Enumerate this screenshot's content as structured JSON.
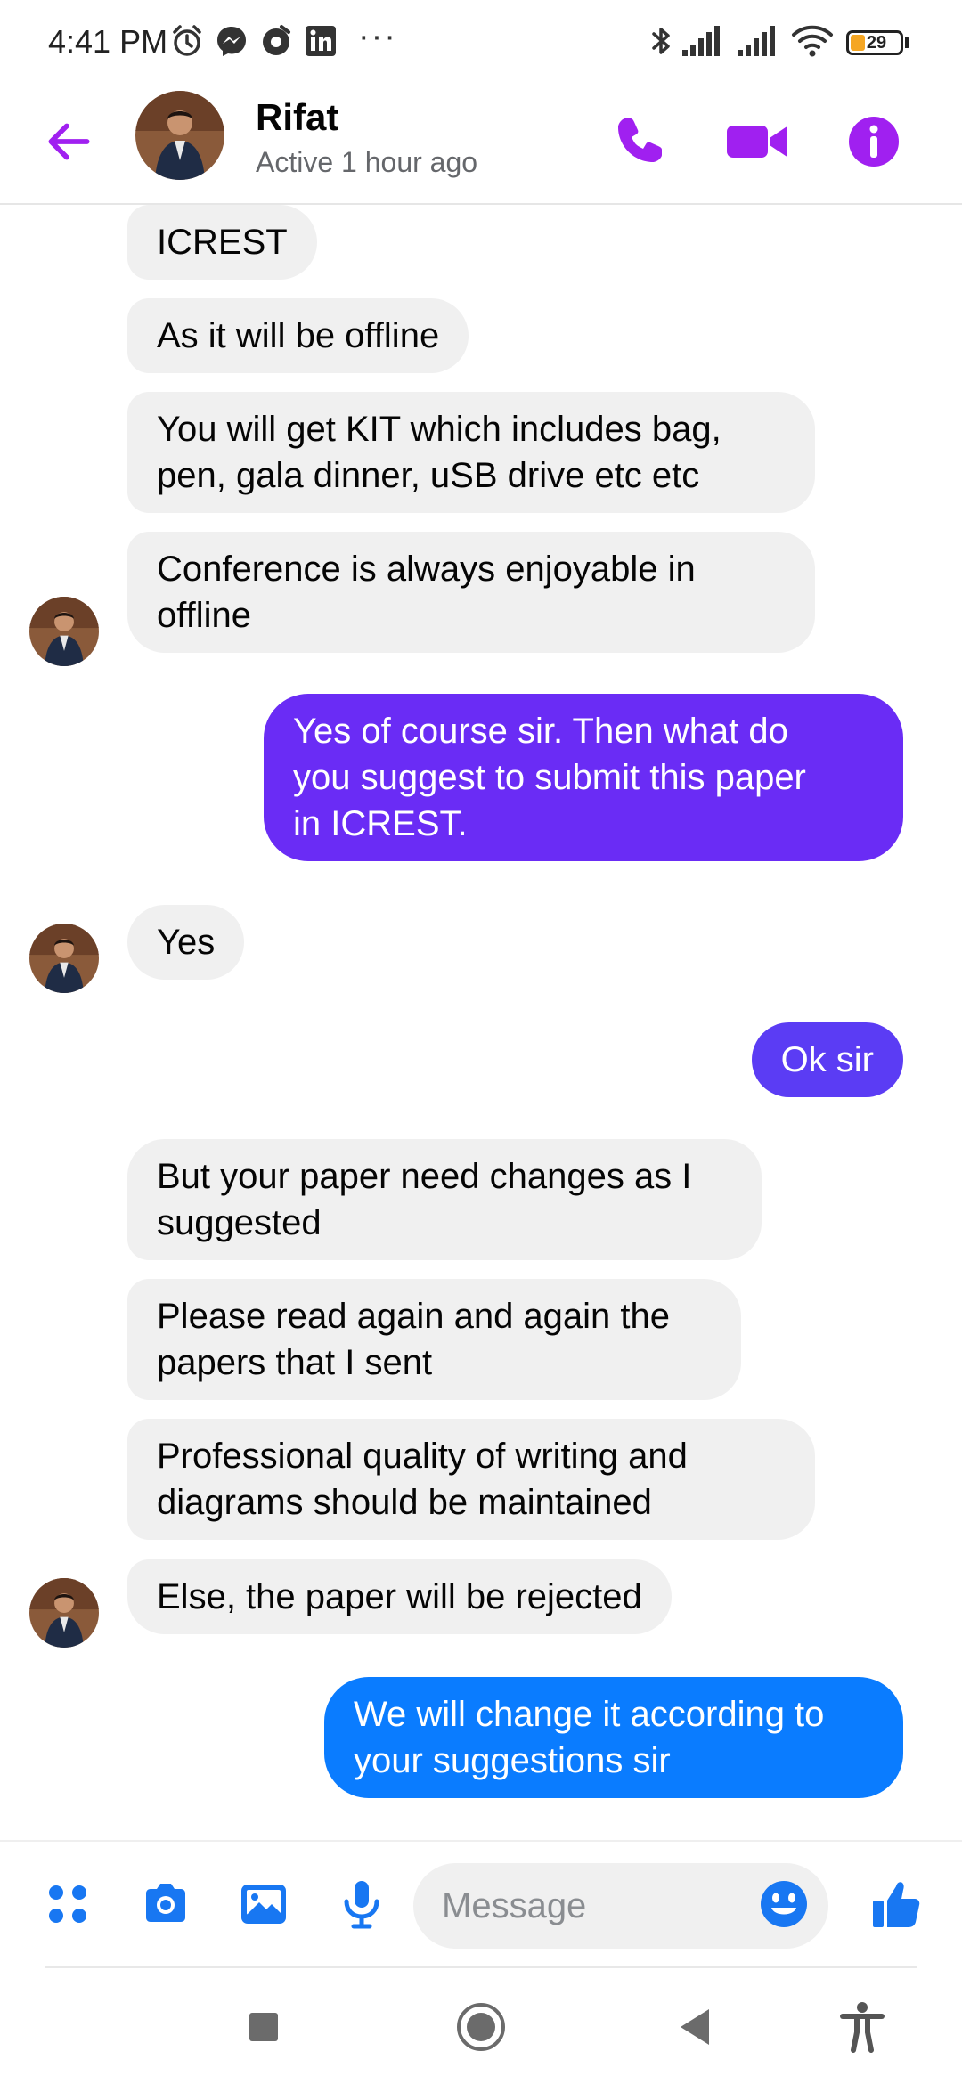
{
  "status_bar": {
    "time": "4:41 PM",
    "more_dots": "···",
    "battery_level": "29",
    "battery_fraction": 0.29,
    "left_icons": [
      "alarm-icon",
      "messenger-icon",
      "notification-app-icon",
      "linkedin-icon"
    ],
    "right_icons": [
      "bluetooth-icon",
      "signal-icon",
      "signal-icon",
      "wifi-icon",
      "battery-icon"
    ]
  },
  "header": {
    "name": "Rifat",
    "status": "Active 1 hour ago",
    "icons": [
      "back-arrow-icon",
      "phone-icon",
      "video-camera-icon",
      "info-icon"
    ],
    "accent_color": "#a020f0"
  },
  "messages": [
    {
      "side": "in",
      "text": "ICREST"
    },
    {
      "side": "in",
      "text": "As it will be offline"
    },
    {
      "side": "in",
      "text": "You will get KIT which includes bag,\npen, gala dinner, uSB drive etc etc"
    },
    {
      "side": "in",
      "text": "Conference is always enjoyable in\noffline"
    },
    {
      "side": "out",
      "text": "Yes of course sir. Then what do\nyou suggest to submit this paper\nin ICREST."
    },
    {
      "side": "in",
      "text": "Yes"
    },
    {
      "side": "out",
      "text": "Ok sir"
    },
    {
      "side": "in",
      "text": "But your paper need changes as I\nsuggested"
    },
    {
      "side": "in",
      "text": "Please read again and again the\npapers that I sent"
    },
    {
      "side": "in",
      "text": "Professional quality of writing and\ndiagrams should be maintained"
    },
    {
      "side": "in",
      "text": "Else, the paper will be rejected"
    },
    {
      "side": "out",
      "text": "We will change it according to\nyour suggestions sir"
    }
  ],
  "composer": {
    "placeholder": "Message",
    "icons": [
      "menu-dots-icon",
      "camera-icon",
      "gallery-icon",
      "microphone-icon",
      "emoji-icon",
      "thumbs-up-icon"
    ]
  },
  "nav_bar": {
    "icons": [
      "recent-apps-icon",
      "home-icon",
      "back-icon",
      "accessibility-icon"
    ]
  },
  "colors": {
    "outgoing_purple": "#6a2cf5",
    "outgoing_indigo": "#5b3cf4",
    "outgoing_blue": "#0a7cff",
    "incoming_bg": "#f0f0f0",
    "messenger_blue": "#1877f2"
  }
}
